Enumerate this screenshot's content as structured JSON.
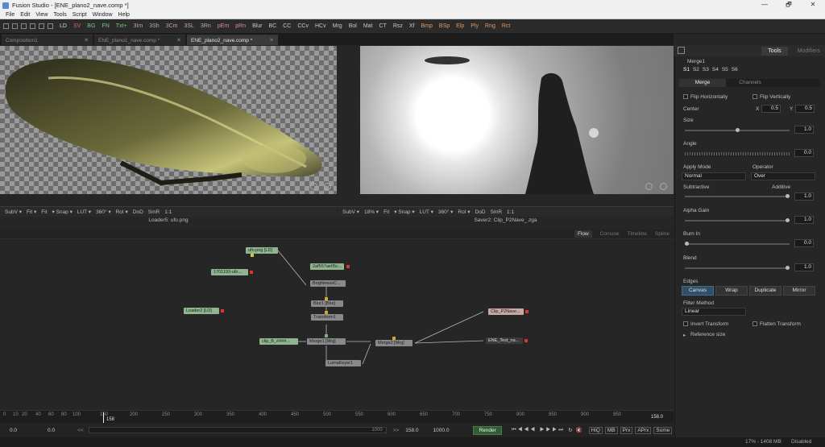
{
  "window": {
    "title": "Fusion Studio - [ENE_plano2_nave.comp *]",
    "min": "—",
    "max": "🗗",
    "close": "✕"
  },
  "menu": [
    "File",
    "Edit",
    "View",
    "Tools",
    "Script",
    "Window",
    "Help"
  ],
  "toolbar": [
    "LD",
    "SV",
    "BG",
    "FN",
    "Txt+",
    "3Im",
    "3Sh",
    "3Cm",
    "3SL",
    "3Rn",
    "pEm",
    "pRn",
    "Blur",
    "BC",
    "CC",
    "CCv",
    "HCv",
    "Mrg",
    "Bol",
    "Mat",
    "CT",
    "Rsz",
    "Xf",
    "Bmp",
    "BSp",
    "Elp",
    "Ply",
    "Rng",
    "Rct"
  ],
  "tabs": [
    {
      "label": "Composition1",
      "close": "✕"
    },
    {
      "label": "ENE_plano1_nave.comp *",
      "close": "✕"
    },
    {
      "label": "ENE_plano2_nave.comp *",
      "close": "✕"
    }
  ],
  "viewer_left": {
    "corner_text": "...",
    "controls": [
      "SubV ▾",
      "Fit ▾",
      "Fit",
      "▾ Snap ▾",
      "LUT ▾",
      "360° ▾",
      "RoI ▾",
      "DoD",
      "SmR",
      "1:1"
    ],
    "name": "Loader5: ufo.png"
  },
  "viewer_right": {
    "controls": [
      "SubV ▾",
      "18% ▾",
      "Fit",
      "▾ Snap ▾",
      "LUT ▾",
      "360° ▾",
      "RoI ▾",
      "DoD",
      "SmR",
      "1:1"
    ],
    "name": "Saver2: Clip_P2Nave_.zga"
  },
  "node_tabs": [
    "Flow",
    "Console",
    "Timeline",
    "Spline"
  ],
  "nodes": {
    "ufo": "ufo.png  [LD]",
    "node2": "2af557ae05c...",
    "node3": "1701193-ufo...",
    "brightness": "BrightnessC...",
    "blur": "Blur1  [Blur]",
    "transform": "Transform1",
    "loader2": "Loader2  [LD]",
    "clipb": "clip_B_####...",
    "merge1": "Merge1  [Mrg]",
    "merge2": "Merge2  [Mrg]",
    "luma": "LumaKeyer1",
    "saver": "Clip_P2Nave...",
    "ene": "ENE_Test_na..."
  },
  "timeline": {
    "ticks": [
      "0",
      "10",
      "20",
      "40",
      "60",
      "80",
      "100",
      "150",
      "200",
      "250",
      "300",
      "350",
      "400",
      "450",
      "500",
      "550",
      "600",
      "650",
      "700",
      "750",
      "800",
      "850",
      "900",
      "950"
    ],
    "current": "158",
    "end_marker": "158.0"
  },
  "transport": {
    "start": "0.0",
    "start2": "0.0",
    "range_mid": "1000",
    "cur": "158.0",
    "end": "1000.0",
    "render": "Render",
    "toggles": [
      "HiQ",
      "MB",
      "Prx",
      "APrx",
      "Some"
    ]
  },
  "status": {
    "memory": "17% - 1408 MB",
    "state": "Disabled"
  },
  "inspector": {
    "tab_tools": "Tools",
    "tab_modifiers": "Modifiers",
    "tool_name": "Merge1",
    "slots": [
      "S1",
      "S2",
      "S3",
      "S4",
      "S5",
      "S6"
    ],
    "subtab_merge": "Merge",
    "subtab_channels": "Channels",
    "flip_h": "Flip Horizontally",
    "flip_v": "Flip Vertically",
    "center_label": "Center",
    "x_label": "X",
    "x_value": "0.5",
    "y_label": "Y",
    "y_value": "0.5",
    "size_label": "Size",
    "size_value": "1.0",
    "angle_label": "Angle",
    "angle_value": "0.0",
    "apply_mode_label": "Apply Mode",
    "apply_mode_value": "Normal",
    "operator_label": "Operator",
    "operator_value": "Over",
    "subtractive": "Subtractive",
    "additive": "Additive",
    "subadd_value": "1.0",
    "alpha_gain_label": "Alpha Gain",
    "alpha_gain_value": "1.0",
    "burn_in_label": "Burn In",
    "burn_in_value": "0.0",
    "blend_label": "Blend",
    "blend_value": "1.0",
    "edges_label": "Edges",
    "edges": [
      "Canvas",
      "Wrap",
      "Duplicate",
      "Mirror"
    ],
    "filter_label": "Filter Method",
    "filter_value": "Linear",
    "invert_transform": "Invert Transform",
    "flatten_transform": "Flatten Transform",
    "reference_size": "Reference size"
  }
}
